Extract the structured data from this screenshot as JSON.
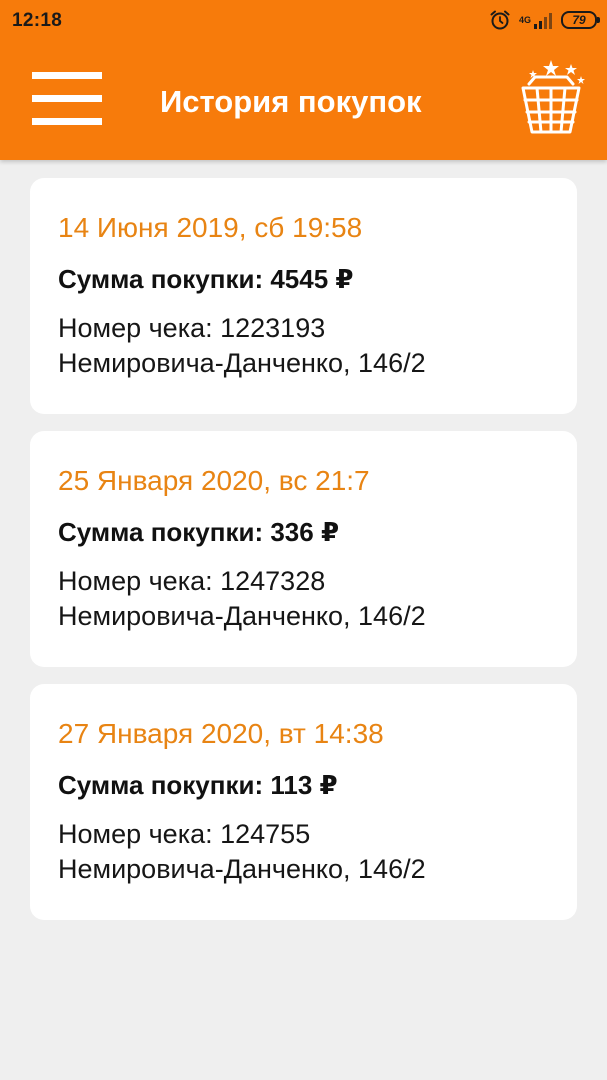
{
  "status_bar": {
    "time": "12:18",
    "network": "4G",
    "battery": "79"
  },
  "header": {
    "title": "История покупок"
  },
  "purchases": [
    {
      "date": "14 Июня 2019, сб 19:58",
      "sum": "Сумма покупки: 4545 ₽",
      "receipt": "Номер чека: 1223193",
      "address": "Немировича-Данченко, 146/2"
    },
    {
      "date": "25 Января 2020, вс 21:7",
      "sum": "Сумма покупки: 336 ₽",
      "receipt": "Номер чека: 1247328",
      "address": "Немировича-Данченко, 146/2"
    },
    {
      "date": "27 Января 2020, вт 14:38",
      "sum": "Сумма покупки: 113 ₽",
      "receipt": "Номер чека: 124755",
      "address": "Немировича-Данченко, 146/2"
    }
  ],
  "colors": {
    "brand": "#f77b0b",
    "date_text": "#e88413",
    "background": "#efefef",
    "card": "#ffffff"
  },
  "icons": {
    "menu": "hamburger-menu-icon",
    "basket": "shopping-basket-stars-icon",
    "alarm": "alarm-clock-icon",
    "signal": "cell-signal-icon",
    "battery": "battery-icon"
  }
}
